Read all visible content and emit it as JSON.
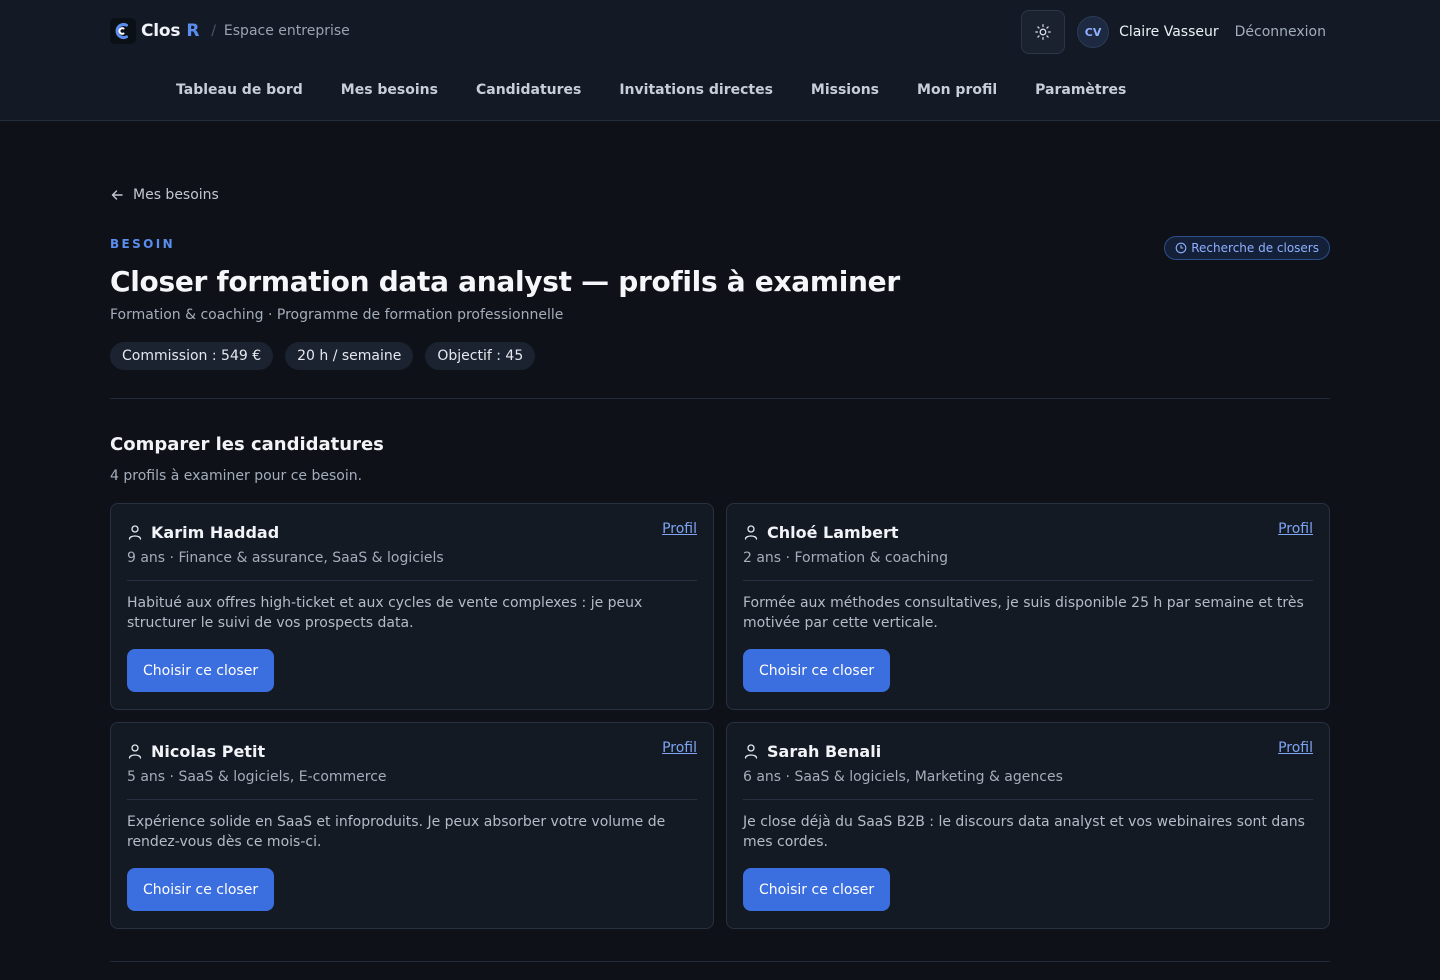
{
  "brand": {
    "name": "Clos",
    "suffix": "R",
    "separator": "/",
    "section": "Espace entreprise"
  },
  "user": {
    "initials": "CV",
    "name": "Claire Vasseur",
    "logout_label": "Déconnexion"
  },
  "nav": [
    "Tableau de bord",
    "Mes besoins",
    "Candidatures",
    "Invitations directes",
    "Missions",
    "Mon profil",
    "Paramètres"
  ],
  "back_link": "Mes besoins",
  "besoin": {
    "eyebrow": "BESOIN",
    "status": "Recherche de closers",
    "title": "Closer formation data analyst — profils à examiner",
    "subtitle": "Formation & coaching · Programme de formation professionnelle",
    "chips": [
      "Commission : 549 €",
      "20 h / semaine",
      "Objectif : 45"
    ]
  },
  "compare": {
    "title": "Comparer les candidatures",
    "subtitle": "4 profils à examiner pour ce besoin.",
    "profile_label": "Profil",
    "choose_label": "Choisir ce closer",
    "candidates": [
      {
        "name": "Karim Haddad",
        "meta": "9 ans · Finance & assurance, SaaS & logiciels",
        "message": "Habitué aux offres high-ticket et aux cycles de vente complexes : je peux structurer le suivi de vos prospects data."
      },
      {
        "name": "Chloé Lambert",
        "meta": "2 ans · Formation & coaching",
        "message": "Formée aux méthodes consultatives, je suis disponible 25 h par semaine et très motivée par cette verticale."
      },
      {
        "name": "Nicolas Petit",
        "meta": "5 ans · SaaS & logiciels, E-commerce",
        "message": "Expérience solide en SaaS et infoproduits. Je peux absorber votre volume de rendez-vous dès ce mois-ci."
      },
      {
        "name": "Sarah Benali",
        "meta": "6 ans · SaaS & logiciels, Marketing & agences",
        "message": "Je close déjà du SaaS B2B : le discours data analyst et vos webinaires sont dans mes cordes."
      }
    ]
  },
  "colors": {
    "accent": "#3b6fe0",
    "link": "#7ea4f3",
    "background": "#0e1117",
    "card": "#141a24"
  },
  "icons": {
    "theme": "sun-icon",
    "back": "arrow-left-icon",
    "status": "clock-icon",
    "candidate": "user-icon",
    "logo": "brand-logo-icon"
  }
}
